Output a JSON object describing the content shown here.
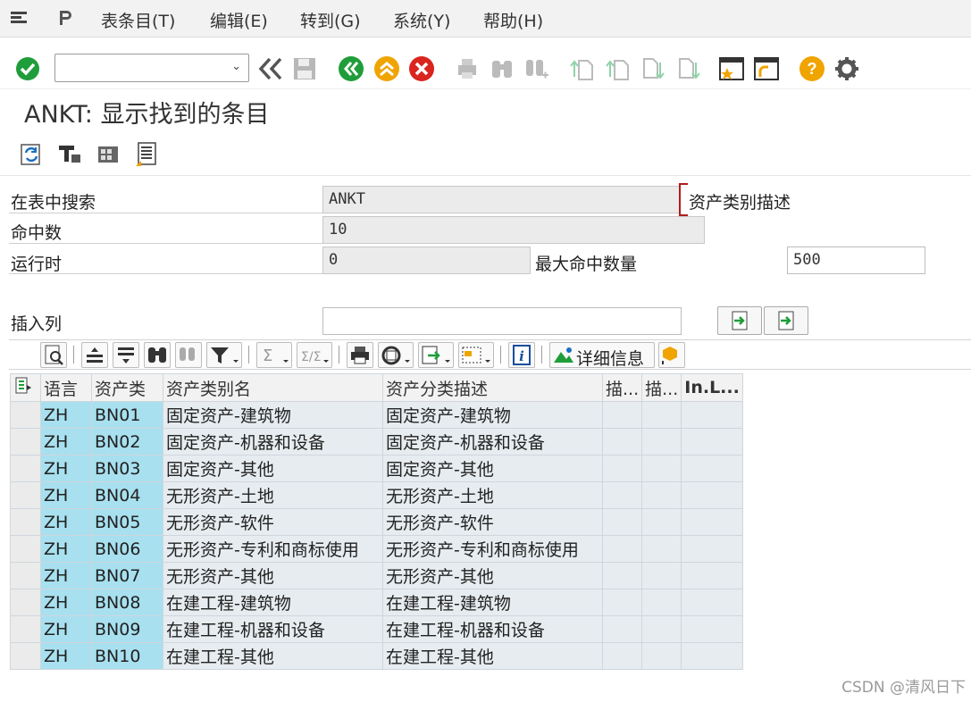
{
  "menu": {
    "items": [
      "表条目(T)",
      "编辑(E)",
      "转到(G)",
      "系统(Y)",
      "帮助(H)"
    ]
  },
  "toolbar": {
    "command_value": "",
    "icons": [
      "enter-icon",
      "back-icon",
      "save-icon",
      "green-back-icon",
      "exit-icon",
      "cancel-icon",
      "print-icon",
      "find-icon",
      "find-next-icon",
      "first-page-icon",
      "prev-page-icon",
      "next-page-icon",
      "last-page-icon",
      "new-session-icon",
      "shortcut-icon",
      "help-icon",
      "settings-icon"
    ]
  },
  "page": {
    "title": "ANKT: 显示找到的条目"
  },
  "form": {
    "search_table_label": "在表中搜索",
    "search_table_value": "ANKT",
    "table_description": "资产类别描述",
    "hits_label": "命中数",
    "hits_value": "10",
    "runtime_label": "运行时",
    "runtime_value": "0",
    "max_hits_label": "最大命中数量",
    "max_hits_value": "500",
    "insert_col_label": "插入列",
    "insert_col_value": ""
  },
  "grid_toolbar": {
    "details_label": "详细信息"
  },
  "grid": {
    "headers": [
      "语言",
      "资产类",
      "资产类别名",
      "资产分类描述",
      "描...",
      "描...",
      "In.L..."
    ],
    "rows": [
      [
        "ZH",
        "BN01",
        "固定资产-建筑物",
        "固定资产-建筑物"
      ],
      [
        "ZH",
        "BN02",
        "固定资产-机器和设备",
        "固定资产-机器和设备"
      ],
      [
        "ZH",
        "BN03",
        "固定资产-其他",
        "固定资产-其他"
      ],
      [
        "ZH",
        "BN04",
        "无形资产-土地",
        "无形资产-土地"
      ],
      [
        "ZH",
        "BN05",
        "无形资产-软件",
        "无形资产-软件"
      ],
      [
        "ZH",
        "BN06",
        "无形资产-专利和商标使用",
        "无形资产-专利和商标使用"
      ],
      [
        "ZH",
        "BN07",
        "无形资产-其他",
        "无形资产-其他"
      ],
      [
        "ZH",
        "BN08",
        "在建工程-建筑物",
        "在建工程-建筑物"
      ],
      [
        "ZH",
        "BN09",
        "在建工程-机器和设备",
        "在建工程-机器和设备"
      ],
      [
        "ZH",
        "BN10",
        "在建工程-其他",
        "在建工程-其他"
      ]
    ]
  },
  "watermark": "CSDN @清风日下",
  "colors": {
    "key_cell": "#a8e0ef",
    "value_cell": "#e7ecf0",
    "green": "#1f9d3a",
    "orange": "#f0a400",
    "red": "#d9251d"
  }
}
